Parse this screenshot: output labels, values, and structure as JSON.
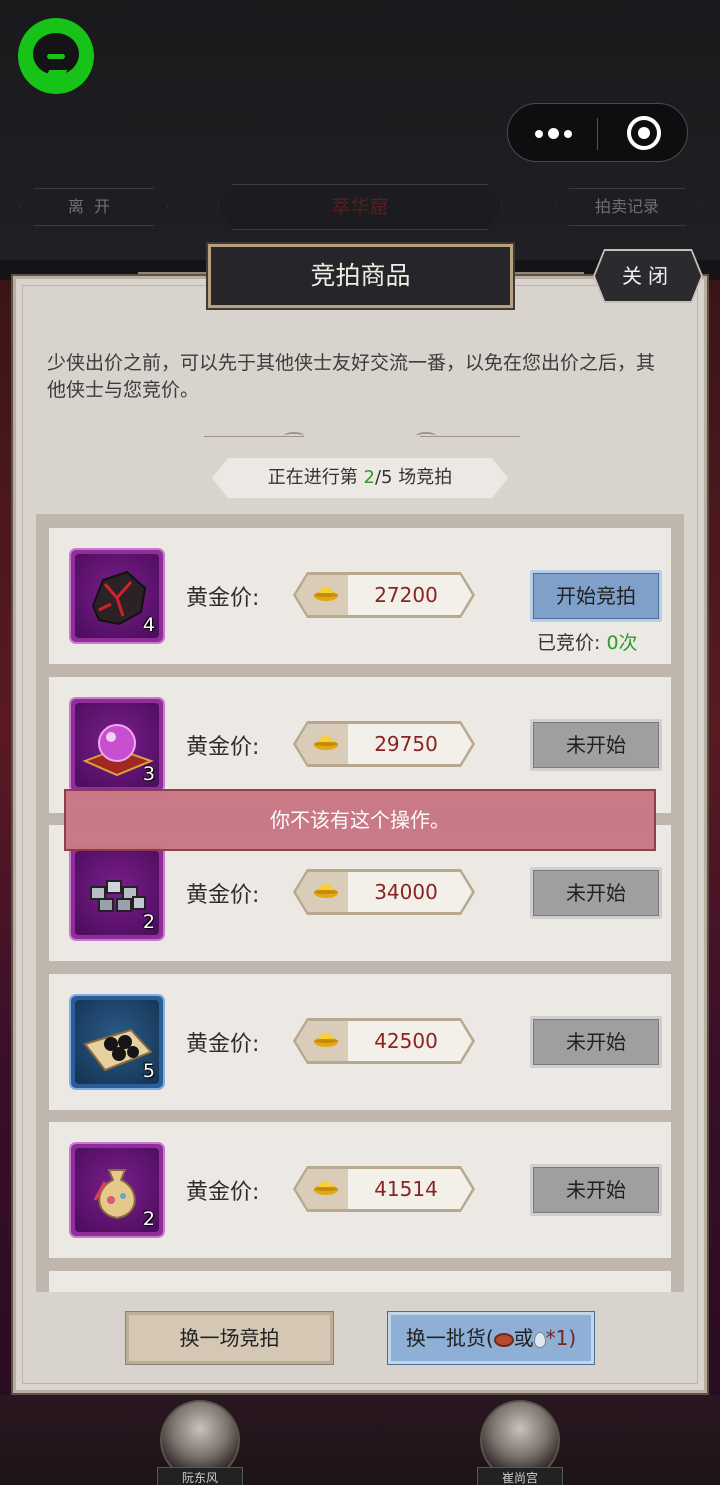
{
  "nav": {
    "leave_label": "离开",
    "title": "萃华窟",
    "record_label": "拍卖记录"
  },
  "panel": {
    "title": "竞拍商品",
    "close_label": "关闭",
    "intro": "少侠出价之前，可以先于其他侠士友好交流一番，以免在您出价之后，其他侠士与您竞价。",
    "round": {
      "prefix": "正在进行第 ",
      "current": "2",
      "total": "/5",
      "suffix": " 场竞拍"
    }
  },
  "items": [
    {
      "count": "4",
      "price_label": "黄金价:",
      "price": "27200",
      "action": "开始竞拍",
      "state": "active",
      "bid_label": "已竞价: ",
      "bid_count": "0次",
      "frame": "purple"
    },
    {
      "count": "3",
      "price_label": "黄金价:",
      "price": "29750",
      "action": "未开始",
      "state": "idle",
      "frame": "purple"
    },
    {
      "count": "2",
      "price_label": "黄金价:",
      "price": "34000",
      "action": "未开始",
      "state": "idle",
      "frame": "purple"
    },
    {
      "count": "5",
      "price_label": "黄金价:",
      "price": "42500",
      "action": "未开始",
      "state": "idle",
      "frame": "blue"
    },
    {
      "count": "2",
      "price_label": "黄金价:",
      "price": "41514",
      "action": "未开始",
      "state": "idle",
      "frame": "purple"
    }
  ],
  "toast": "你不该有这个操作。",
  "bottom": {
    "change_auction_label": "换一场竞拍",
    "change_goods_prefix": "换一批货(",
    "change_goods_or": "或",
    "change_goods_suffix": "*1)"
  },
  "avatars": [
    {
      "name": "阮东风"
    },
    {
      "name": "崔尚宫"
    }
  ],
  "colors": {
    "panel_bg": "#d9d3cd",
    "price_text": "#8b2323",
    "highlight_green": "#2f9b2f",
    "toast_bg": "#c97784",
    "active_button": "#7fa0c8"
  }
}
